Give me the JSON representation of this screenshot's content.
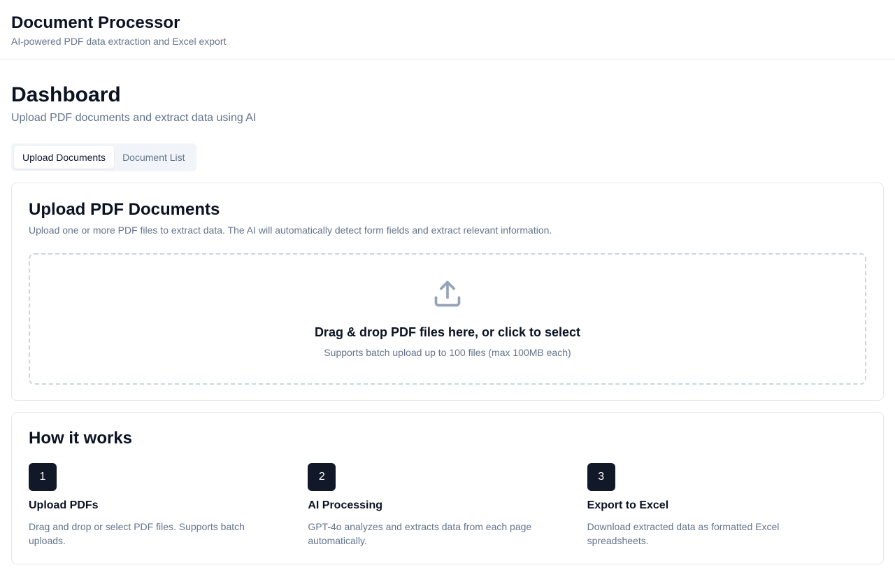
{
  "header": {
    "title": "Document Processor",
    "subtitle": "AI-powered PDF data extraction and Excel export"
  },
  "page": {
    "title": "Dashboard",
    "subtitle": "Upload PDF documents and extract data using AI"
  },
  "tabs": [
    {
      "label": "Upload Documents",
      "active": true
    },
    {
      "label": "Document List",
      "active": false
    }
  ],
  "upload": {
    "title": "Upload PDF Documents",
    "description": "Upload one or more PDF files to extract data. The AI will automatically detect form fields and extract relevant information.",
    "dropzone": {
      "icon": "upload-icon",
      "title": "Drag & drop PDF files here, or click to select",
      "hint": "Supports batch upload up to 100 files (max 100MB each)"
    }
  },
  "how": {
    "title": "How it works",
    "steps": [
      {
        "number": "1",
        "title": "Upload PDFs",
        "description": "Drag and drop or select PDF files. Supports batch uploads."
      },
      {
        "number": "2",
        "title": "AI Processing",
        "description": "GPT-4o analyzes and extracts data from each page automatically."
      },
      {
        "number": "3",
        "title": "Export to Excel",
        "description": "Download extracted data as formatted Excel spreadsheets."
      }
    ]
  },
  "colors": {
    "primary": "#111827",
    "muted_text": "#64748b",
    "border": "#e5e7eb",
    "tab_bg": "#f1f5f9"
  }
}
